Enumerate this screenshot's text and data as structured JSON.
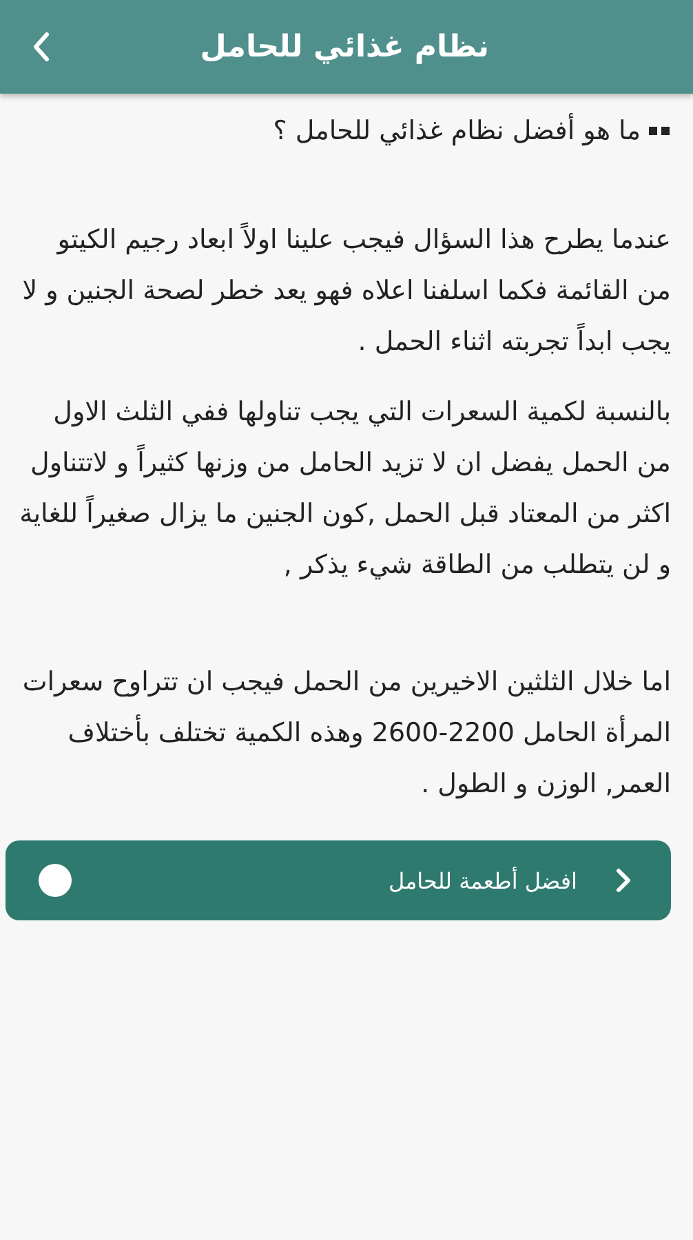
{
  "app_bar": {
    "title": "نظام غذائي للحامل"
  },
  "question": "ما هو أفضل نظام غذائي للحامل ؟",
  "paragraphs": [
    "عندما يطرح هذا السؤال فيجب علينا اولاً ابعاد رجيم الكيتو من القائمة فكما اسلفنا اعلاه فهو يعد خطر لصحة الجنين و لا يجب ابداً تجربته اثناء الحمل .",
    "بالنسبة لكمية السعرات التي يجب تناولها ففي الثلث الاول من الحمل يفضل ان لا تزيد الحامل من وزنها كثيراً و لاتتناول اكثر من المعتاد قبل الحمل ,كون الجنين ما يزال صغيراً للغاية و لن يتطلب من الطاقة شيء يذكر ,",
    "اما خلال الثلثين الاخيرين من الحمل فيجب ان تتراوح سعرات المرأة الحامل 2200-2600 وهذه الكمية تختلف بأختلاف العمر, الوزن و الطول ."
  ],
  "next_button": {
    "label": "افضل أطعمة للحامل"
  }
}
